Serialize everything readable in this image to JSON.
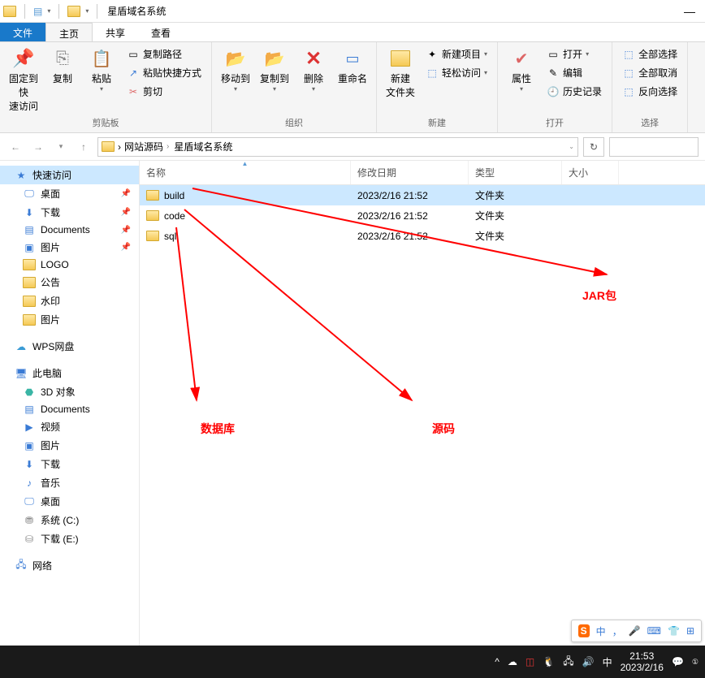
{
  "title": "星盾域名系统",
  "tabs": {
    "file": "文件",
    "home": "主页",
    "share": "共享",
    "view": "查看"
  },
  "ribbon": {
    "clipboard": {
      "label": "剪贴板",
      "pin": "固定到快\n速访问",
      "copy": "复制",
      "paste": "粘贴",
      "copypath": "复制路径",
      "shortcut": "粘贴快捷方式",
      "cut": "剪切"
    },
    "organize": {
      "label": "组织",
      "moveto": "移动到",
      "copyto": "复制到",
      "delete": "删除",
      "rename": "重命名"
    },
    "new": {
      "label": "新建",
      "newfolder": "新建\n文件夹",
      "newitem": "新建项目",
      "easyaccess": "轻松访问"
    },
    "open": {
      "label": "打开",
      "properties": "属性",
      "open": "打开",
      "edit": "编辑",
      "history": "历史记录"
    },
    "select": {
      "label": "选择",
      "all": "全部选择",
      "none": "全部取消",
      "invert": "反向选择"
    }
  },
  "breadcrumb": {
    "root": "网站源码",
    "current": "星盾域名系统"
  },
  "columns": {
    "name": "名称",
    "date": "修改日期",
    "type": "类型",
    "size": "大小"
  },
  "files": [
    {
      "name": "build",
      "date": "2023/2/16 21:52",
      "type": "文件夹"
    },
    {
      "name": "code",
      "date": "2023/2/16 21:52",
      "type": "文件夹"
    },
    {
      "name": "sql",
      "date": "2023/2/16 21:52",
      "type": "文件夹"
    }
  ],
  "sidebar": {
    "quick": "快速访问",
    "desktop": "桌面",
    "downloads": "下载",
    "documents": "Documents",
    "pictures": "图片",
    "logo": "LOGO",
    "gonggao": "公告",
    "shuiyin": "水印",
    "pictures2": "图片",
    "wps": "WPS网盘",
    "thispc": "此电脑",
    "obj3d": "3D 对象",
    "documents2": "Documents",
    "videos": "视频",
    "pictures3": "图片",
    "downloads2": "下载",
    "music": "音乐",
    "desktop2": "桌面",
    "sysc": "系统 (C:)",
    "dle": "下载 (E:)",
    "network": "网络"
  },
  "annotations": {
    "jar": "JAR包",
    "source": "源码",
    "db": "数据库"
  },
  "ime": {
    "zhong": "中",
    "dot": "，"
  },
  "taskbar": {
    "time": "21:53",
    "date": "2023/2/16",
    "ime": "中"
  }
}
